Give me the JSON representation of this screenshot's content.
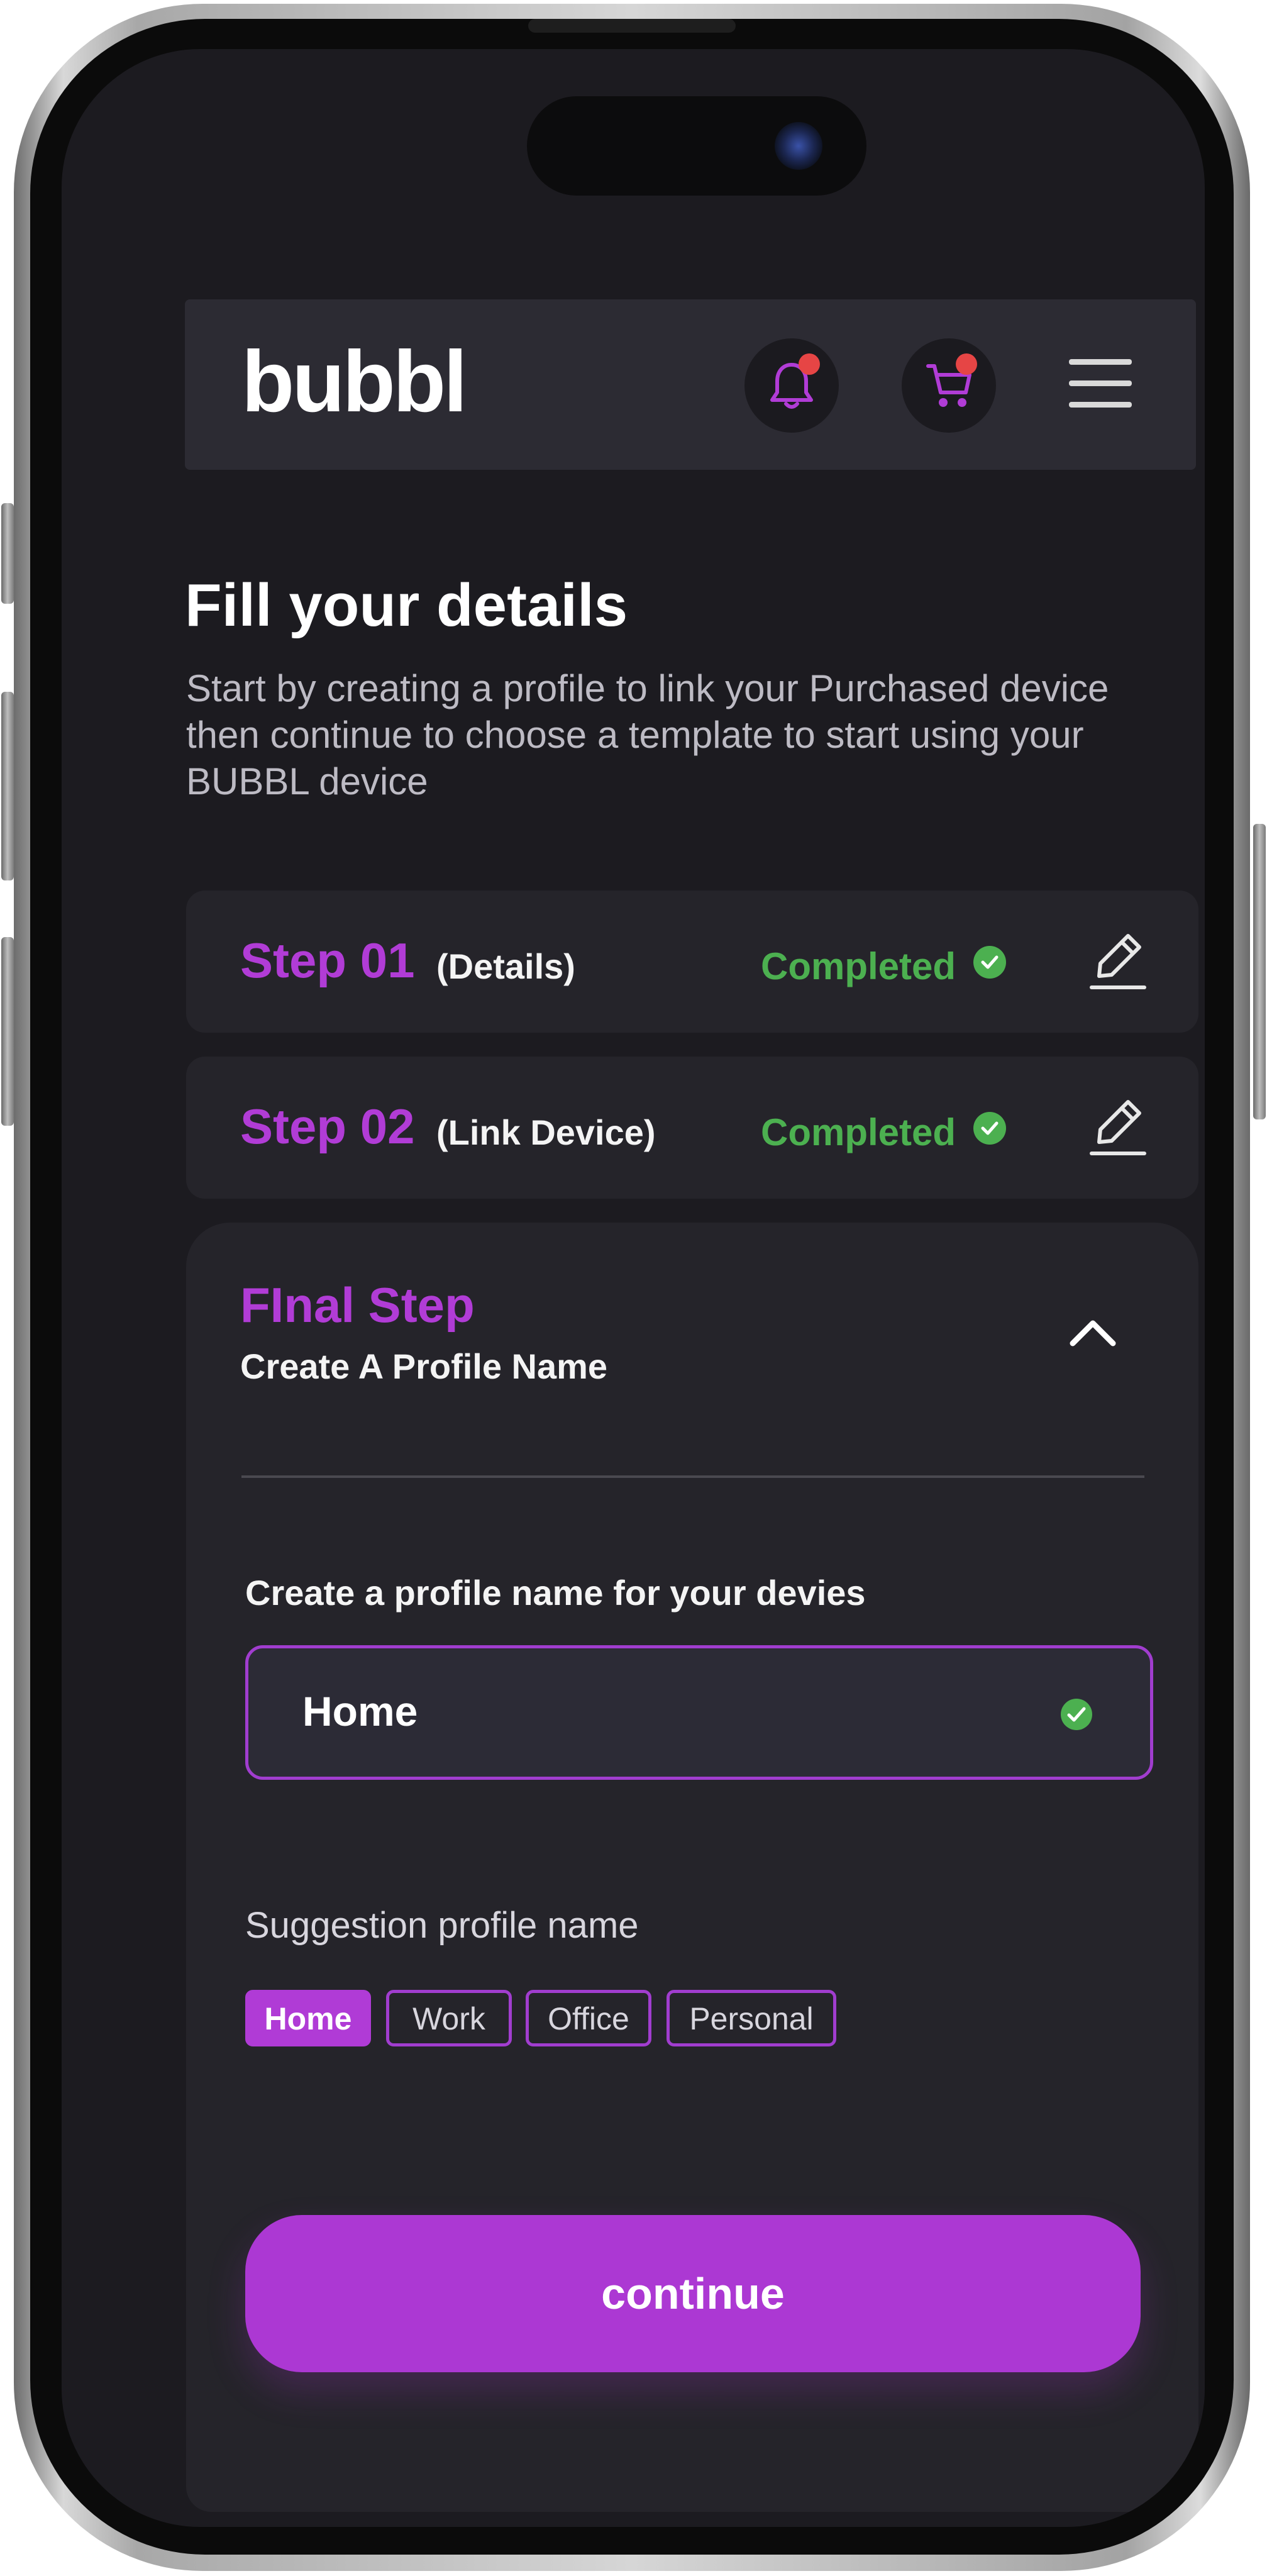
{
  "header": {
    "logo_text": "bubbl",
    "icons": [
      "bell-icon",
      "cart-icon",
      "hamburger-menu-icon"
    ]
  },
  "intro": {
    "title": "Fill your details",
    "description": "Start by creating a profile to link your Purchased device then continue to choose a template to  start using your BUBBL device"
  },
  "steps": [
    {
      "title": "Step 01",
      "subtitle": "(Details)",
      "status": "Completed"
    },
    {
      "title": "Step 02",
      "subtitle": "(Link Device)",
      "status": "Completed"
    }
  ],
  "final_step": {
    "title": "FInal Step",
    "subtitle": "Create A Profile Name",
    "field_label": "Create a profile name for your devies",
    "field_value": "Home",
    "suggestion_label": "Suggestion profile name",
    "suggestions": [
      "Home",
      "Work",
      "Office",
      "Personal"
    ],
    "selected_suggestion": "Home",
    "continue_label": "continue"
  },
  "colors": {
    "accent": "#b03bd6",
    "success": "#4cb050",
    "background": "#1c1b20",
    "card": "#25242a",
    "notification": "#e64545"
  }
}
